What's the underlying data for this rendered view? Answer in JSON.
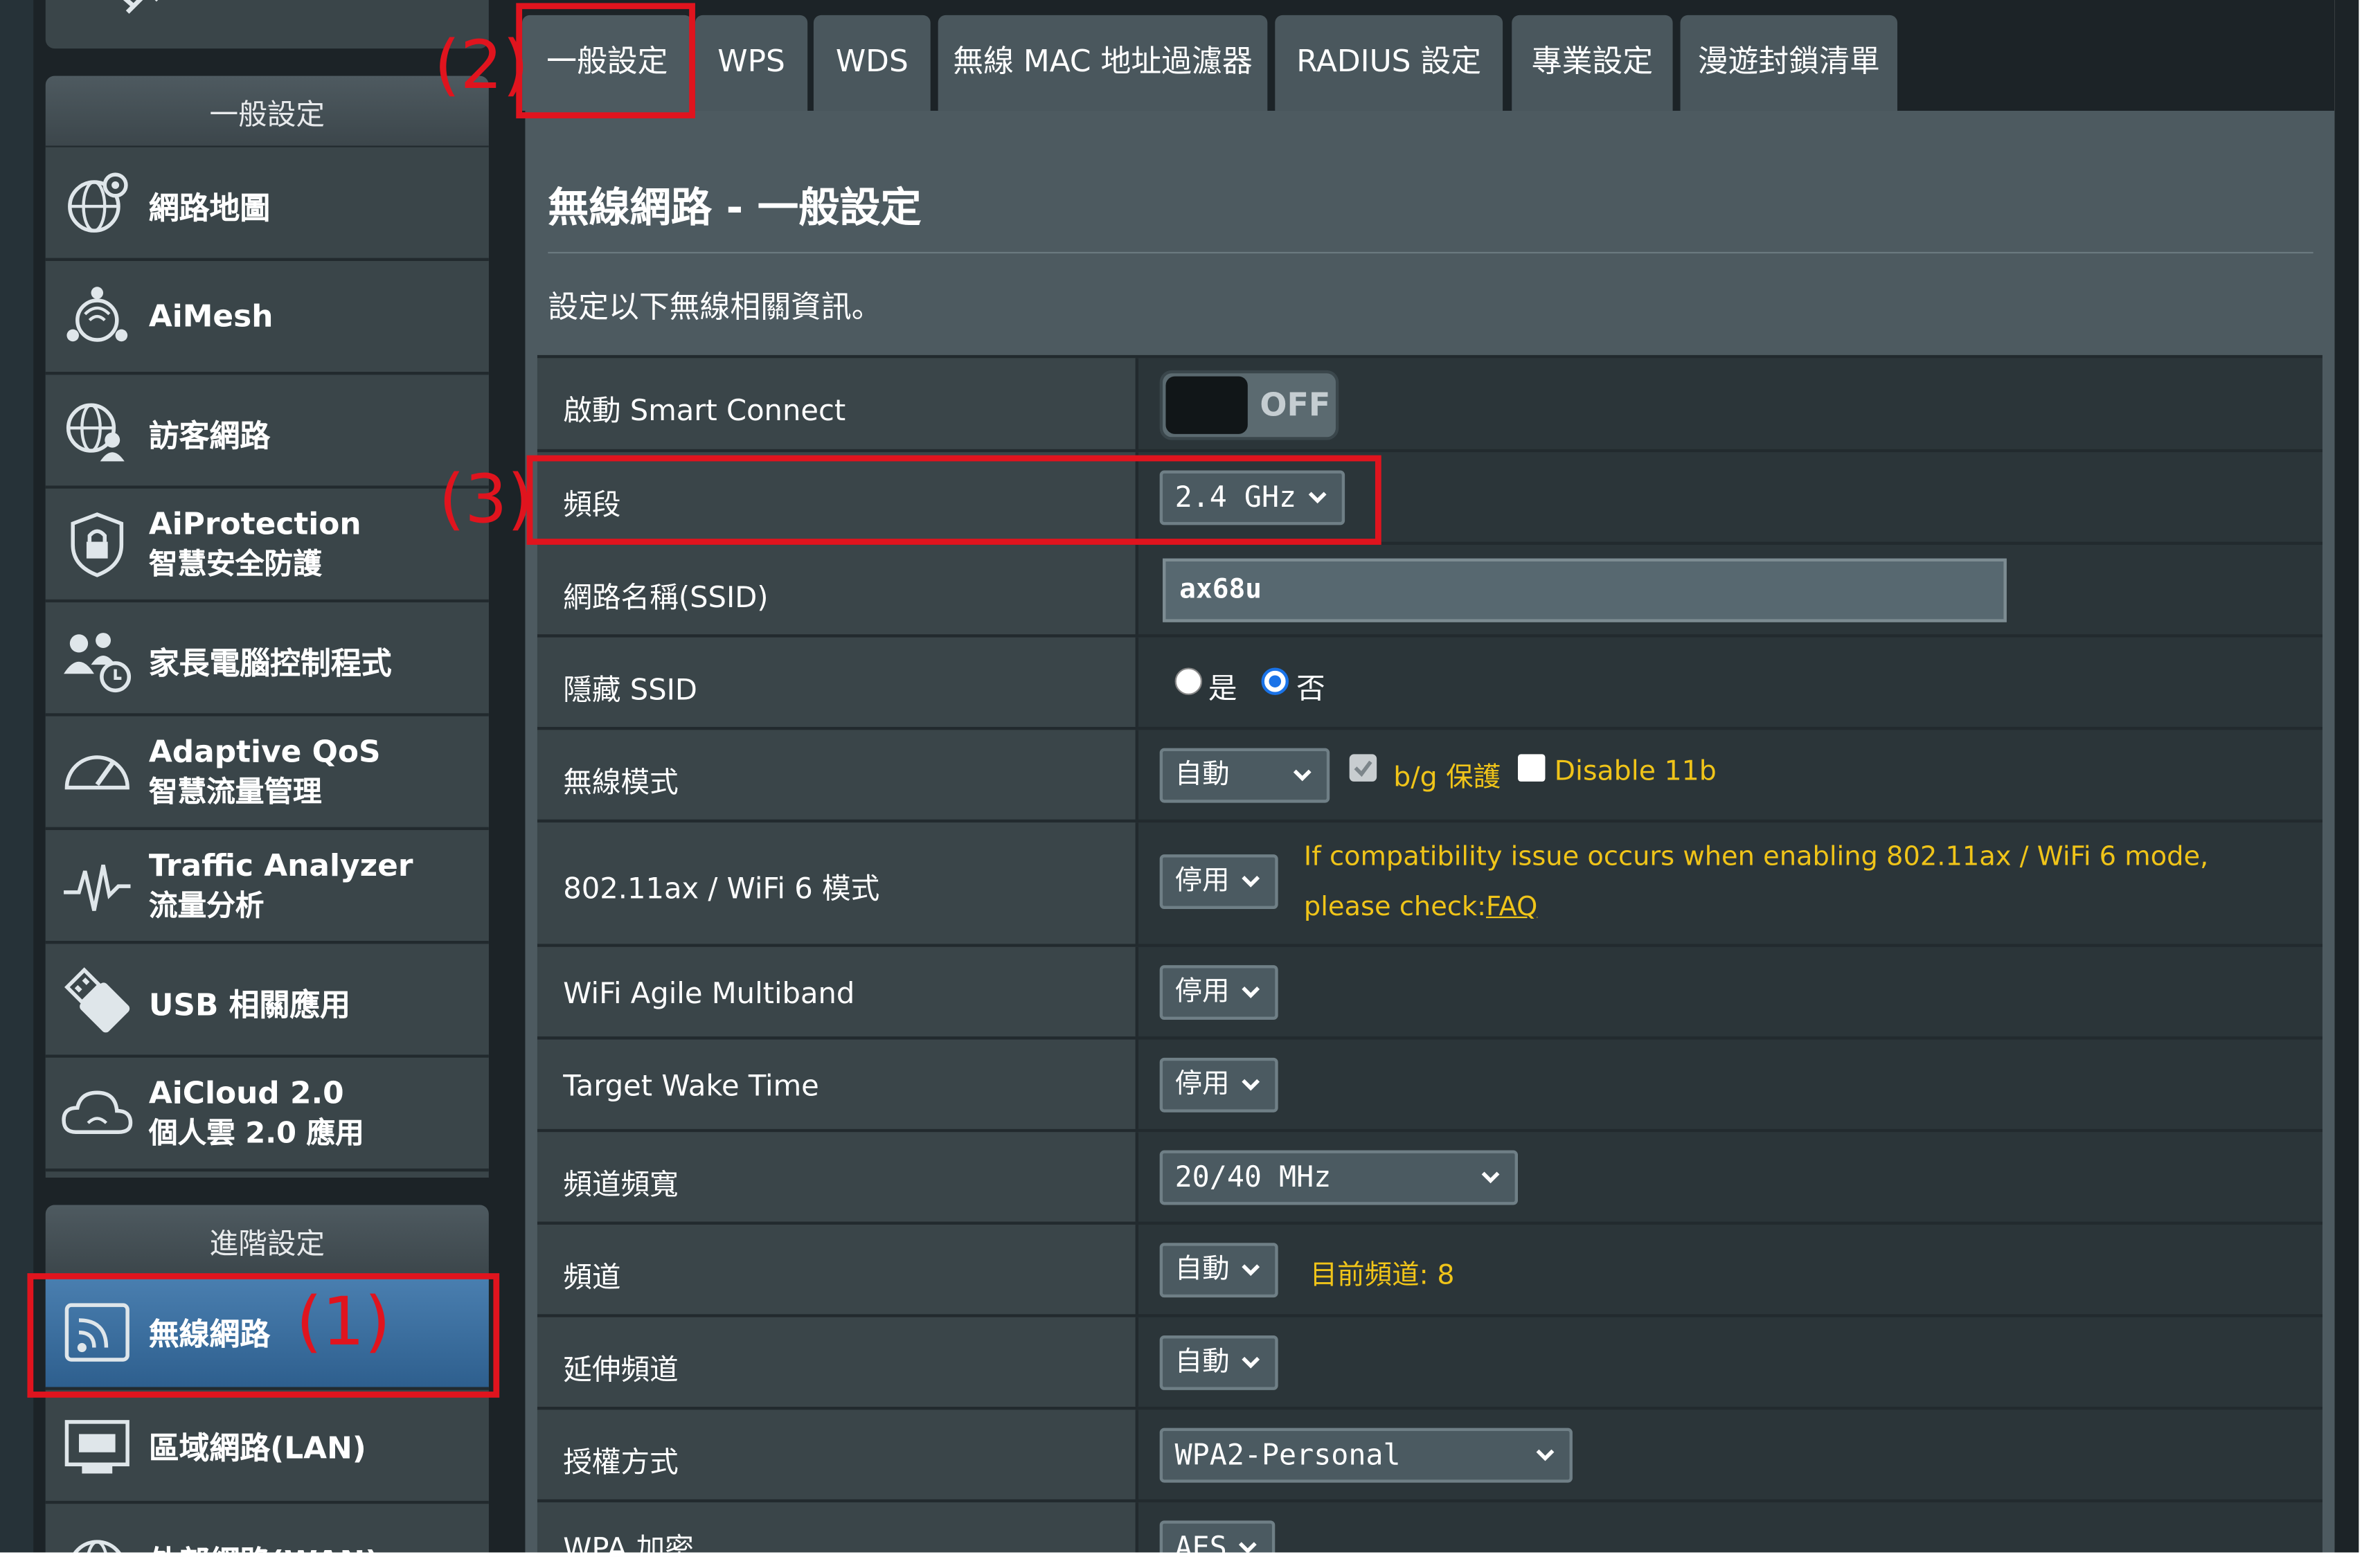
{
  "sidebar": {
    "general_header": "一般設定",
    "advanced_header": "進階設定",
    "general_items": [
      {
        "line1": "網路地圖",
        "line2": "",
        "icon": "globe-map-icon"
      },
      {
        "line1": "AiMesh",
        "line2": "",
        "icon": "mesh-network-icon"
      },
      {
        "line1": "訪客網路",
        "line2": "",
        "icon": "guest-network-icon"
      },
      {
        "line1": "AiProtection",
        "line2": "智慧安全防護",
        "icon": "shield-lock-icon"
      },
      {
        "line1": "家長電腦控制程式",
        "line2": "",
        "icon": "parental-control-icon"
      },
      {
        "line1": "Adaptive QoS",
        "line2": "智慧流量管理",
        "icon": "speedometer-icon"
      },
      {
        "line1": "Traffic Analyzer",
        "line2": "流量分析",
        "icon": "traffic-wave-icon"
      },
      {
        "line1": "USB 相關應用",
        "line2": "",
        "icon": "usb-icon"
      },
      {
        "line1": "AiCloud 2.0",
        "line2": "個人雲 2.0 應用",
        "icon": "cloud-icon"
      }
    ],
    "advanced_items": [
      {
        "line1": "無線網路",
        "line2": "",
        "icon": "wireless-icon",
        "active": true
      },
      {
        "line1": "區域網路(LAN)",
        "line2": "",
        "icon": "lan-icon"
      },
      {
        "line1": "外部網路(WAN)",
        "line2": "",
        "icon": "wan-globe-icon"
      }
    ]
  },
  "tabs": [
    "一般設定",
    "WPS",
    "WDS",
    "無線 MAC 地址過濾器",
    "RADIUS 設定",
    "專業設定",
    "漫遊封鎖清單"
  ],
  "active_tab": "一般設定",
  "panel": {
    "title": "無線網路 - 一般設定",
    "description": "設定以下無線相關資訊。"
  },
  "settings": {
    "smart_connect": {
      "label": "啟動 Smart Connect",
      "toggle": "OFF"
    },
    "band": {
      "label": "頻段",
      "value": "2.4 GHz"
    },
    "ssid": {
      "label": "網路名稱(SSID)",
      "value": "ax68u"
    },
    "hide_ssid": {
      "label": "隱藏 SSID",
      "yes": "是",
      "no": "否",
      "selected": "否"
    },
    "wireless_mode": {
      "label": "無線模式",
      "value": "自動",
      "bg_protect": "b/g 保護",
      "disable_11b": "Disable 11b",
      "bg_checked": true,
      "disable_11b_checked": false
    },
    "wifi6": {
      "label": "802.11ax / WiFi 6 模式",
      "value": "停用",
      "note_line1": "If compatibility issue occurs when enabling 802.11ax / WiFi 6 mode,",
      "note_prefix": "please check: ",
      "note_link": "FAQ"
    },
    "agile": {
      "label": "WiFi Agile Multiband",
      "value": "停用"
    },
    "twt": {
      "label": "Target Wake Time",
      "value": "停用"
    },
    "bandwidth": {
      "label": "頻道頻寬",
      "value": "20/40 MHz"
    },
    "channel": {
      "label": "頻道",
      "value": "自動",
      "current": "目前頻道: 8"
    },
    "ext_channel": {
      "label": "延伸頻道",
      "value": "自動"
    },
    "auth": {
      "label": "授權方式",
      "value": "WPA2-Personal"
    },
    "wpa_enc": {
      "label": "WPA 加密",
      "value": "AES"
    }
  },
  "annotations": {
    "a1": "(1)",
    "a2": "(2)",
    "a3": "(3)"
  },
  "colors": {
    "highlight_red": "#e0141e",
    "note_yellow": "#f0c419",
    "active_blue": "#3a6e9e"
  }
}
